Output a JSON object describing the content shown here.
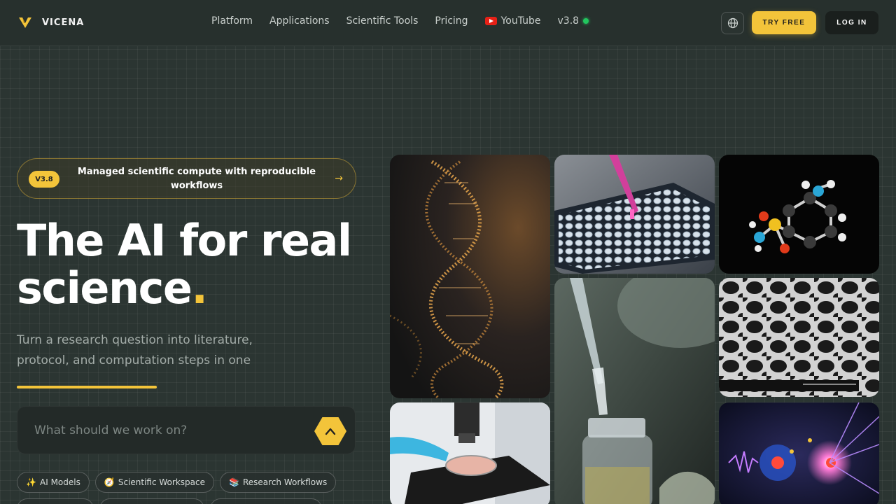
{
  "brand": {
    "name": "VICENA",
    "accent": "#f3c43a"
  },
  "nav": {
    "items": [
      {
        "label": "Platform"
      },
      {
        "label": "Applications"
      },
      {
        "label": "Scientific Tools"
      },
      {
        "label": "Pricing"
      },
      {
        "label": "YouTube",
        "icon": "youtube-icon"
      },
      {
        "label": "v3.8",
        "status": "online"
      }
    ]
  },
  "header": {
    "try_label": "TRY FREE",
    "login_label": "LOG IN",
    "globe_icon": "globe-icon"
  },
  "announcement": {
    "badge": "V3.8",
    "text": "Managed scientific compute with reproducible workflows",
    "arrow": "→"
  },
  "hero": {
    "headline_main": "The AI for real science",
    "headline_dot": ".",
    "subtitle": "Turn a research question into literature, protocol, and computation steps in one"
  },
  "search": {
    "placeholder": "What should we work on?",
    "send_icon": "chevron-up-icon"
  },
  "chips": [
    {
      "icon": "✨",
      "label": "AI Models"
    },
    {
      "icon": "🧭",
      "label": "Scientific Workspace"
    },
    {
      "icon": "📚",
      "label": "Research Workflows"
    }
  ],
  "tiles": [
    {
      "name": "dna-helix-image"
    },
    {
      "name": "pipette-well-plate-image"
    },
    {
      "name": "molecule-model-image"
    },
    {
      "name": "dropper-vial-image"
    },
    {
      "name": "porous-microscopy-image"
    },
    {
      "name": "microscope-petri-image"
    },
    {
      "name": "particle-physics-image"
    }
  ]
}
